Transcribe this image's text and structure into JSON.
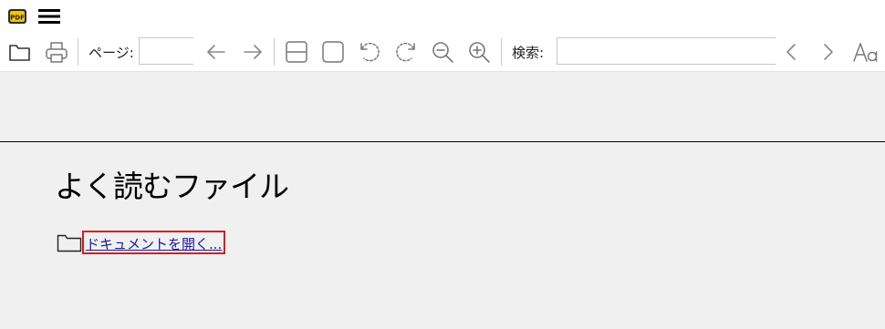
{
  "titlebar": {
    "logo_text": "PDF",
    "menu_icon": "hamburger-menu-icon"
  },
  "toolbar": {
    "page_label": "ページ:",
    "page_value": "",
    "search_label": "検索:",
    "search_value": "",
    "icons": [
      "folder-open-icon",
      "printer-icon",
      "arrow-left-icon",
      "arrow-right-icon",
      "fit-width-icon",
      "fit-page-icon",
      "rotate-left-icon",
      "rotate-right-icon",
      "zoom-out-icon",
      "zoom-in-icon",
      "chevron-left-icon",
      "chevron-right-icon",
      "font-case-icon"
    ]
  },
  "main": {
    "title": "よく読むファイル",
    "open_document_label": "ドキュメントを開く..."
  },
  "colors": {
    "highlight_border": "#e0151b",
    "link_color": "#1a1a99",
    "background": "#f0f0f0"
  }
}
